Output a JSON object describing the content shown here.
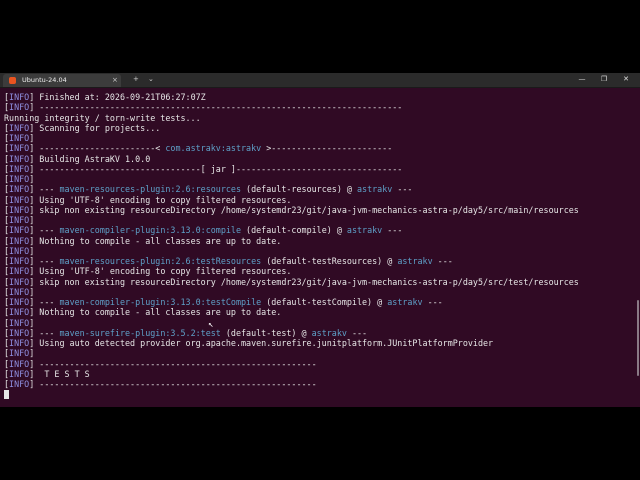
{
  "titlebar": {
    "tab_title": "Ubuntu-24.04",
    "close_glyph": "×",
    "new_tab_glyph": "+",
    "dropdown_glyph": "⌄",
    "minimize_glyph": "—",
    "maximize_glyph": "❐",
    "window_close_glyph": "✕"
  },
  "terminal": {
    "lines": [
      [
        {
          "t": "["
        },
        {
          "t": "INFO",
          "c": "lv"
        },
        {
          "t": "] Finished at: 2026-09-21T06:27:07Z"
        }
      ],
      [
        {
          "t": "["
        },
        {
          "t": "INFO",
          "c": "lv"
        },
        {
          "t": "] ------------------------------------------------------------------------"
        }
      ],
      [
        {
          "t": "Running integrity / torn-write tests..."
        }
      ],
      [
        {
          "t": "["
        },
        {
          "t": "INFO",
          "c": "lv"
        },
        {
          "t": "] Scanning for projects..."
        }
      ],
      [
        {
          "t": "["
        },
        {
          "t": "INFO",
          "c": "lv"
        },
        {
          "t": "]"
        }
      ],
      [
        {
          "t": "["
        },
        {
          "t": "INFO",
          "c": "lv"
        },
        {
          "t": "] -----------------------< "
        },
        {
          "t": "com.astrakv:astrakv",
          "c": "cy"
        },
        {
          "t": " >------------------------"
        }
      ],
      [
        {
          "t": "["
        },
        {
          "t": "INFO",
          "c": "lv"
        },
        {
          "t": "] Building AstraKV 1.0.0"
        }
      ],
      [
        {
          "t": "["
        },
        {
          "t": "INFO",
          "c": "lv"
        },
        {
          "t": "] --------------------------------[ jar ]---------------------------------"
        }
      ],
      [
        {
          "t": "["
        },
        {
          "t": "INFO",
          "c": "lv"
        },
        {
          "t": "]"
        }
      ],
      [
        {
          "t": "["
        },
        {
          "t": "INFO",
          "c": "lv"
        },
        {
          "t": "] --- "
        },
        {
          "t": "maven-resources-plugin:2.6:resources",
          "c": "cy"
        },
        {
          "t": " (default-resources) @ "
        },
        {
          "t": "astrakv",
          "c": "cy"
        },
        {
          "t": " ---"
        }
      ],
      [
        {
          "t": "["
        },
        {
          "t": "INFO",
          "c": "lv"
        },
        {
          "t": "] Using 'UTF-8' encoding to copy filtered resources."
        }
      ],
      [
        {
          "t": "["
        },
        {
          "t": "INFO",
          "c": "lv"
        },
        {
          "t": "] skip non existing resourceDirectory /home/systemdr23/git/java-jvm-mechanics-astra-p/day5/src/main/resources"
        }
      ],
      [
        {
          "t": "["
        },
        {
          "t": "INFO",
          "c": "lv"
        },
        {
          "t": "]"
        }
      ],
      [
        {
          "t": "["
        },
        {
          "t": "INFO",
          "c": "lv"
        },
        {
          "t": "] --- "
        },
        {
          "t": "maven-compiler-plugin:3.13.0:compile",
          "c": "cy"
        },
        {
          "t": " (default-compile) @ "
        },
        {
          "t": "astrakv",
          "c": "cy"
        },
        {
          "t": " ---"
        }
      ],
      [
        {
          "t": "["
        },
        {
          "t": "INFO",
          "c": "lv"
        },
        {
          "t": "] Nothing to compile - all classes are up to date."
        }
      ],
      [
        {
          "t": "["
        },
        {
          "t": "INFO",
          "c": "lv"
        },
        {
          "t": "]"
        }
      ],
      [
        {
          "t": "["
        },
        {
          "t": "INFO",
          "c": "lv"
        },
        {
          "t": "] --- "
        },
        {
          "t": "maven-resources-plugin:2.6:testResources",
          "c": "cy"
        },
        {
          "t": " (default-testResources) @ "
        },
        {
          "t": "astrakv",
          "c": "cy"
        },
        {
          "t": " ---"
        }
      ],
      [
        {
          "t": "["
        },
        {
          "t": "INFO",
          "c": "lv"
        },
        {
          "t": "] Using 'UTF-8' encoding to copy filtered resources."
        }
      ],
      [
        {
          "t": "["
        },
        {
          "t": "INFO",
          "c": "lv"
        },
        {
          "t": "] skip non existing resourceDirectory /home/systemdr23/git/java-jvm-mechanics-astra-p/day5/src/test/resources"
        }
      ],
      [
        {
          "t": "["
        },
        {
          "t": "INFO",
          "c": "lv"
        },
        {
          "t": "]"
        }
      ],
      [
        {
          "t": "["
        },
        {
          "t": "INFO",
          "c": "lv"
        },
        {
          "t": "] --- "
        },
        {
          "t": "maven-compiler-plugin:3.13.0:testCompile",
          "c": "cy"
        },
        {
          "t": " (default-testCompile) @ "
        },
        {
          "t": "astrakv",
          "c": "cy"
        },
        {
          "t": " ---"
        }
      ],
      [
        {
          "t": "["
        },
        {
          "t": "INFO",
          "c": "lv"
        },
        {
          "t": "] Nothing to compile - all classes are up to date."
        }
      ],
      [
        {
          "t": "["
        },
        {
          "t": "INFO",
          "c": "lv"
        },
        {
          "t": "]"
        }
      ],
      [
        {
          "t": "["
        },
        {
          "t": "INFO",
          "c": "lv"
        },
        {
          "t": "] --- "
        },
        {
          "t": "maven-surefire-plugin:3.5.2:test",
          "c": "cy"
        },
        {
          "t": " (default-test) @ "
        },
        {
          "t": "astrakv",
          "c": "cy"
        },
        {
          "t": " ---"
        }
      ],
      [
        {
          "t": "["
        },
        {
          "t": "INFO",
          "c": "lv"
        },
        {
          "t": "] Using auto detected provider org.apache.maven.surefire.junitplatform.JUnitPlatformProvider"
        }
      ],
      [
        {
          "t": "["
        },
        {
          "t": "INFO",
          "c": "lv"
        },
        {
          "t": "]"
        }
      ],
      [
        {
          "t": "["
        },
        {
          "t": "INFO",
          "c": "lv"
        },
        {
          "t": "] -------------------------------------------------------"
        }
      ],
      [
        {
          "t": "["
        },
        {
          "t": "INFO",
          "c": "lv"
        },
        {
          "t": "]  T E S T S"
        }
      ],
      [
        {
          "t": "["
        },
        {
          "t": "INFO",
          "c": "lv"
        },
        {
          "t": "] -------------------------------------------------------"
        }
      ]
    ]
  },
  "colors": {
    "terminal_bg": "#300a24",
    "level_text": "#8f8fe0",
    "highlight_text": "#5ea0c8",
    "ubuntu_orange": "#e95420"
  }
}
